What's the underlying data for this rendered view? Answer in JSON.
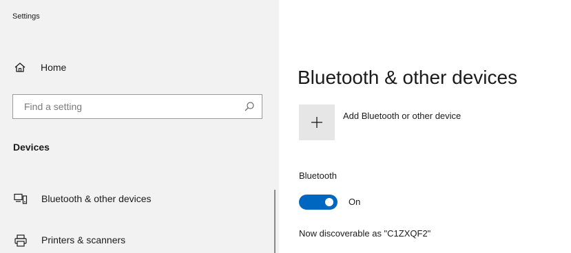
{
  "window": {
    "title": "Settings"
  },
  "sidebar": {
    "home": {
      "label": "Home",
      "icon": "home-icon"
    },
    "search": {
      "placeholder": "Find a setting",
      "value": "",
      "icon": "search-icon"
    },
    "section_heading": "Devices",
    "items": [
      {
        "label": "Bluetooth & other devices",
        "icon": "bluetooth-devices-icon",
        "selected": true
      },
      {
        "label": "Printers & scanners",
        "icon": "printer-icon",
        "selected": false
      }
    ]
  },
  "main": {
    "title": "Bluetooth & other devices",
    "add_device": {
      "label": "Add Bluetooth or other device",
      "icon": "plus-icon"
    },
    "bluetooth": {
      "heading": "Bluetooth",
      "toggle_state": "On",
      "enabled": true
    },
    "discoverable_text": "Now discoverable as \"C1ZXQF2\""
  },
  "colors": {
    "sidebar_bg": "#f2f2f2",
    "accent": "#0067c0",
    "tile_bg": "#e6e6e6"
  }
}
